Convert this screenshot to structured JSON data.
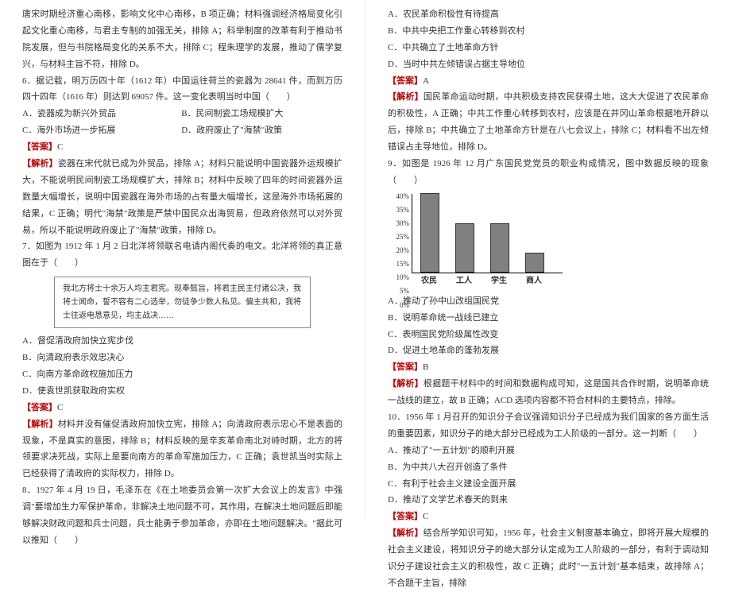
{
  "left": {
    "p1": "唐宋时期经济重心南移，影响文化中心南移，B 项正确；材料强调经济格局变化引起文化重心南移，与君主专制的加强无关，排除 A；科举制度的改革有利于推动书院发展，但与书院格局变化的关系不大，排除 C；程朱理学的发展，推动了儒学复兴，与材料主旨不符，排除 D。",
    "q6_stem": "6．据记载，明万历四十年（1612 年）中国运往荷兰的瓷器为 28641 件，而到万历四十四年（1616 年）则达到 69057 件。这一变化表明当时中国（　　）",
    "q6_A": "A．瓷器成为新兴外贸品",
    "q6_B": "B．民间制瓷工场规模扩大",
    "q6_C": "C．海外市场进一步拓展",
    "q6_D": "D．政府废止了\"海禁\"政策",
    "q6_ans_label": "【答案】",
    "q6_ans": "C",
    "q6_ana_label": "【解析】",
    "q6_ana": "瓷器在宋代就已成为外贸品，排除 A；材料只能说明中国瓷器外运规模扩大，不能说明民间制瓷工场规模扩大，排除 B；材料中反映了四年的时间瓷器外运数量大幅增长，说明中国瓷器在海外市场的占有量大幅增长，这是海外市场拓展的结果，C 正确；明代\"海禁\"政策是严禁中国民众出海贸易，但政府依然可以对外贸易，所以不能说明政府废止了\"海禁\"政策，排除 D。",
    "q7_stem": "7．如图为 1912 年 1 月 2 日北洋将领联名电请内阁代奏的电文。北洋将领的真正意图在于（　　）",
    "q7_quote": "我北方将士十余万人均主君宪。现奉懿旨，将君主民主付诸公决，我将士闻命，誓不容有二心选举，勿徒争少数人私见。偏主共和，我将士往返电恳意见，均主战决……",
    "q7_A": "A．督促清政府加快立宪步伐",
    "q7_B": "B．向清政府表示效忠决心",
    "q7_C": "C．向南方革命政权施加压力",
    "q7_D": "D．使袁世凯获取政府实权",
    "q7_ans_label": "【答案】",
    "q7_ans": "C",
    "q7_ana_label": "【解析】",
    "q7_ana": "材料并没有催促清政府加快立宪，排除 A；向清政府表示忠心不是表面的现象，不是真实的意图，排除 B；材料反映的是辛亥革命南北对峙时期，北方的将领要求决死战，实际上是要向南方的革命军施加压力，C 正确；袁世凯当时实际上已经获得了清政府的实际权力，排除 D。",
    "q8_stem": "8．1927 年 4 月 19 日，毛泽东在《在土地委员会第一次扩大会议上的发言》中强调\"要增加生力军保护革命，非解决土地问题不可，其作用，在解决土地问题后即能够解决财政问题和兵士问题，兵士能勇于参加革命，亦即在土地问题解决。\"据此可以推知（　　）"
  },
  "right": {
    "q8_A": "A．农民革命积极性有待提高",
    "q8_B": "B．中共中央把工作重心转移到农村",
    "q8_C": "C．中共确立了土地革命方针",
    "q8_D": "D．当时中共左倾错误占据主导地位",
    "q8_ans_label": "【答案】",
    "q8_ans": "A",
    "q8_ana_label": "【解析】",
    "q8_ana": "国民革命运动时期，中共积极支持农民获得土地，这大大促进了农民革命的积极性，A 正确；中共工作重心转移到农村，应该是在井冈山革命根据地开辟以后，排除 B；中共确立了土地革命方针是在八七会议上，排除 C；材料看不出左倾错误占主导地位，排除 D。",
    "q9_stem": "9．如图是 1926 年 12 月广东国民党党员的职业构成情况，图中数据反映的现象（　　）",
    "q9_A": "A．推动了孙中山改组国民党",
    "q9_B": "B．说明革命统一战线已建立",
    "q9_C": "C．表明国民党阶级属性改变",
    "q9_D": "D．促进土地革命的蓬勃发展",
    "q9_ans_label": "【答案】",
    "q9_ans": "B",
    "q9_ana_label": "【解析】",
    "q9_ana": "根据题干材料中的时间和数据构成可知，这是国共合作时期，说明革命统一战线的建立，故 B 正确；ACD 选项内容都不符合材料的主要特点，排除。",
    "q10_stem": "10．1956 年 1 月召开的知识分子会议强调知识分子已经成为我们国家的各方面生活的重要因素，知识分子的绝大部分已经成为工人阶级的一部分。这一判断（　　）",
    "q10_A": "A．推动了\"一五计划\"的顺利开展",
    "q10_B": "B．为中共八大召开创造了条件",
    "q10_C": "C．有利于社会主义建设全面开展",
    "q10_D": "D．推动了文学艺术春天的到来",
    "q10_ans_label": "【答案】",
    "q10_ans": "C",
    "q10_ana_label": "【解析】",
    "q10_ana": "结合所学知识可知，1956 年，社会主义制度基本确立，即将开展大规模的社会主义建设，将知识分子的绝大部分认定成为工人阶级的一部分，有利于调动知识分子建设社会主义的积极性，故 C 正确；此时\"一五计划\"基本结束，故排除 A；不合题干主旨，排除"
  },
  "chart_data": {
    "type": "bar",
    "categories": [
      "农民",
      "工人",
      "学生",
      "商人"
    ],
    "values": [
      40,
      25,
      25,
      10
    ],
    "ylabel": "",
    "ylim": [
      0,
      40
    ],
    "yticks": [
      "40%",
      "35%",
      "30%",
      "25%",
      "20%",
      "15%",
      "10%",
      "5%",
      "0%"
    ]
  }
}
